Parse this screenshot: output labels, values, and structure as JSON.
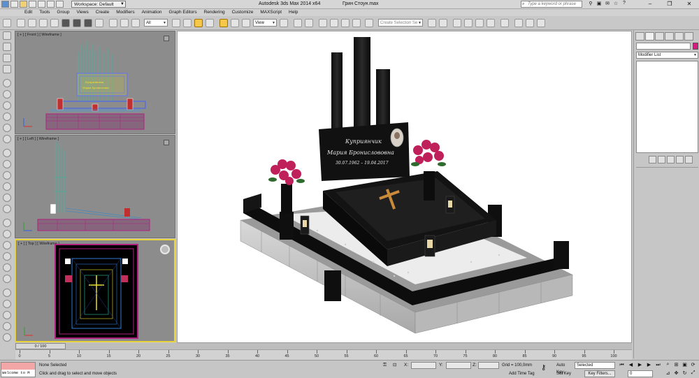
{
  "window": {
    "title": "Autodesk 3ds Max  2014 x64",
    "file": "Грин Стоун.max",
    "workspace": "Workspace: Default",
    "search_placeholder": "Type a keyword or phrase"
  },
  "menu": [
    "Edit",
    "Tools",
    "Group",
    "Views",
    "Create",
    "Modifiers",
    "Animation",
    "Graph Editors",
    "Rendering",
    "Customize",
    "MAXScript",
    "Help"
  ],
  "toolbar": {
    "selection_filter": "All",
    "reference_coord": "View",
    "named_selection_placeholder": "Create Selection Se"
  },
  "viewports": {
    "front": {
      "label": "[ + ] [ Front ] [ Wireframe ]"
    },
    "left": {
      "label": "[ + ] [ Left ] [ Wireframe ]"
    },
    "top": {
      "label": "[ + ] [ Top ] [ Wireframe ]"
    }
  },
  "render": {
    "plaque_line1": "Куприянчик",
    "plaque_line2": "Мария Бронислововна",
    "plaque_line3": "30.07.1962 – 19.04.2017"
  },
  "command_panel": {
    "modifier_list": "Modifier List",
    "accent_color": "#d6197c"
  },
  "timeline": {
    "frame_display": "0 / 100",
    "ticks": [
      "0",
      "5",
      "10",
      "15",
      "20",
      "25",
      "30",
      "35",
      "40",
      "45",
      "50",
      "55",
      "60",
      "65",
      "70",
      "75",
      "80",
      "85",
      "90",
      "95",
      "100"
    ]
  },
  "status": {
    "maxscript_text": "Welcome to M",
    "selection_status": "None Selected",
    "prompt": "Click and drag to select and move objects",
    "x_label": "X:",
    "y_label": "Y:",
    "z_label": "Z:",
    "grid": "Grid = 100,0mm",
    "add_time_tag": "Add Time Tag",
    "auto_key": "Auto Key",
    "set_key": "Set Key",
    "selected_dd": "Selected",
    "key_filters": "Key Filters...",
    "current_frame": "0"
  }
}
